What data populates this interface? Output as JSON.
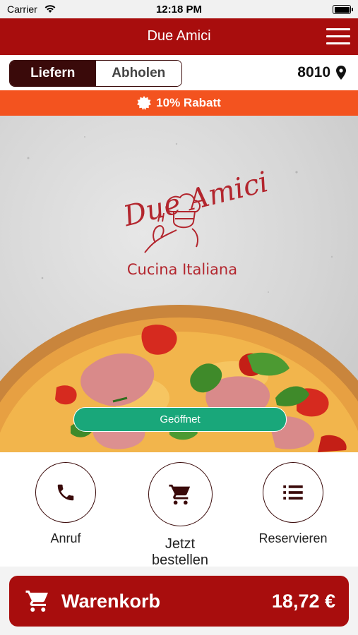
{
  "status_bar": {
    "carrier": "Carrier",
    "time": "12:18 PM"
  },
  "nav": {
    "title": "Due Amici"
  },
  "mode": {
    "deliver_label": "Liefern",
    "pickup_label": "Abholen",
    "active": "deliver",
    "postal_code": "8010"
  },
  "promo": {
    "text": "10% Rabatt"
  },
  "hero": {
    "logo_script": "Due Amici",
    "logo_subtitle": "Cucina Italiana",
    "status_badge": "Geöffnet"
  },
  "actions": [
    {
      "label": "Anruf",
      "icon": "phone-icon"
    },
    {
      "label": "Jetzt bestellen",
      "icon": "cart-icon"
    },
    {
      "label": "Reservieren",
      "icon": "list-icon"
    }
  ],
  "cart": {
    "label": "Warenkorb",
    "total": "18,72 €",
    "icon": "cart-icon"
  },
  "colors": {
    "brand": "#a80d0d",
    "dark": "#3a0a0a",
    "promo": "#f3531f",
    "open": "#19a77a"
  }
}
